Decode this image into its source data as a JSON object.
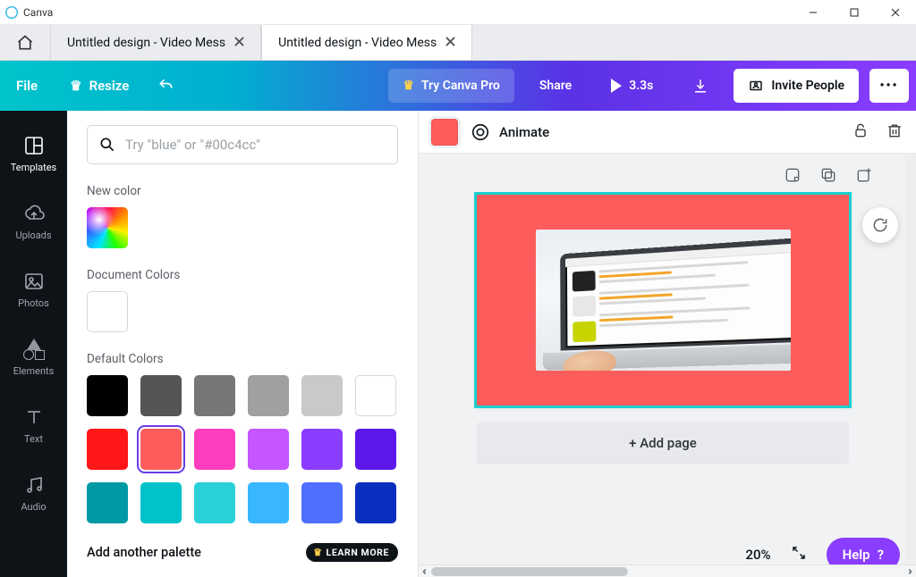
{
  "window": {
    "app_name": "Canva"
  },
  "tabs": [
    {
      "label": "Untitled design - Video Mess",
      "active": false
    },
    {
      "label": "Untitled design - Video Mess",
      "active": true
    }
  ],
  "toolbar": {
    "file": "File",
    "resize": "Resize",
    "try_pro": "Try Canva Pro",
    "share": "Share",
    "duration": "3.3s",
    "invite": "Invite People"
  },
  "rail": {
    "templates": "Templates",
    "uploads": "Uploads",
    "photos": "Photos",
    "elements": "Elements",
    "text": "Text",
    "audio": "Audio"
  },
  "panel": {
    "search_placeholder": "Try \"blue\" or \"#00c4cc\"",
    "new_color_label": "New color",
    "doc_colors_label": "Document Colors",
    "doc_colors": [
      "#ffffff"
    ],
    "default_colors_label": "Default Colors",
    "default_colors_row1": [
      "#000000",
      "#555555",
      "#777777",
      "#a0a0a0",
      "#c9c9c9",
      "#ffffff"
    ],
    "default_colors_row2": [
      "#ff1616",
      "#fc5c5c",
      "#ff3ebf",
      "#c455ff",
      "#8a3dff",
      "#5e17eb"
    ],
    "default_colors_row3": [
      "#009aa6",
      "#00c2cb",
      "#2ad1d8",
      "#38b6ff",
      "#4f6fff",
      "#0a2fbf"
    ],
    "selected_swatch": "#fc5c5c",
    "add_palette": "Add another palette",
    "learn_more": "LEARN MORE"
  },
  "context": {
    "active_color": "#fc5c5c",
    "animate": "Animate"
  },
  "canvas": {
    "add_page": "+ Add page",
    "zoom": "20%"
  },
  "help": {
    "label": "Help",
    "q": "?"
  }
}
